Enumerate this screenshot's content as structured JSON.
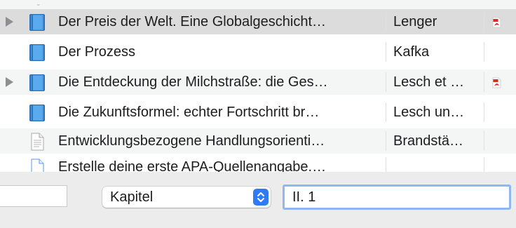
{
  "items": [
    {
      "title": "Der Preis der Welt. Eine Globalgeschicht…",
      "creator": "Lenger",
      "icon": "book-icon",
      "expandable": true,
      "has_pdf": true,
      "selected": true
    },
    {
      "title": "Der Prozess",
      "creator": "Kafka",
      "icon": "book-icon",
      "expandable": false,
      "has_pdf": false,
      "selected": false
    },
    {
      "title": "Die Entdeckung der Milchstraße: die Ges…",
      "creator": "Lesch et …",
      "icon": "book-icon",
      "expandable": true,
      "has_pdf": true,
      "selected": false
    },
    {
      "title": "Die Zukunftsformel: echter Fortschritt br…",
      "creator": "Lesch un…",
      "icon": "book-icon",
      "expandable": false,
      "has_pdf": false,
      "selected": false
    },
    {
      "title": "Entwicklungsbezogene Handlungsorienti…",
      "creator": "Brandstä…",
      "icon": "document-icon",
      "expandable": false,
      "has_pdf": false,
      "selected": false
    },
    {
      "title": "Erstelle deine erste APA-Quellenangabe.…",
      "creator": "",
      "icon": "document-icon",
      "expandable": false,
      "has_pdf": false,
      "selected": false
    }
  ],
  "locator": {
    "type_label": "Kapitel",
    "value": "II. 1"
  },
  "colors": {
    "book": "#3d8ed8",
    "selection": "#dcdcdc",
    "accent": "#2f7bf5",
    "focus_ring": "#8fb8f0"
  }
}
